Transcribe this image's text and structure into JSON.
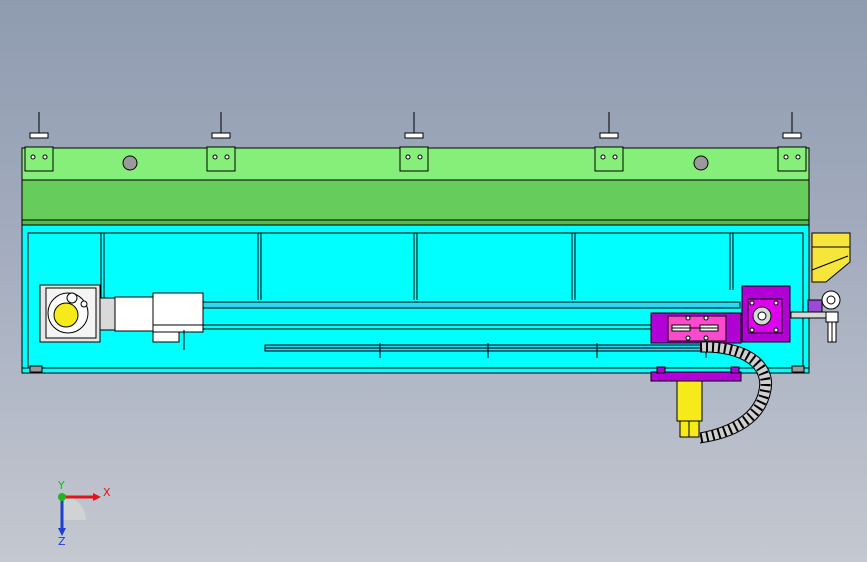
{
  "app": {
    "view": "cad-3d-viewport",
    "background_gradient": [
      "#8f9bb0",
      "#a4adbf",
      "#c4c8d0"
    ]
  },
  "triad": {
    "x_label": "X",
    "y_label": "Y",
    "z_label": "Z",
    "x_color": "#e0141e",
    "y_color": "#1fb51f",
    "z_color": "#1e3fd6"
  },
  "colors": {
    "top_cover": "#86ef7a",
    "top_cover_band": "#66cc5c",
    "frame": "#00ffff",
    "motor_body": "#ffffff",
    "gearbox": "#e5e5e5",
    "carriage": "#b000d6",
    "carriage_plate": "#ff4ad0",
    "cylinder": "#f6ea1a",
    "sensor_bracket": "#f6e63b",
    "cable_chain": "#cfcfcf",
    "outline": "#000000"
  }
}
